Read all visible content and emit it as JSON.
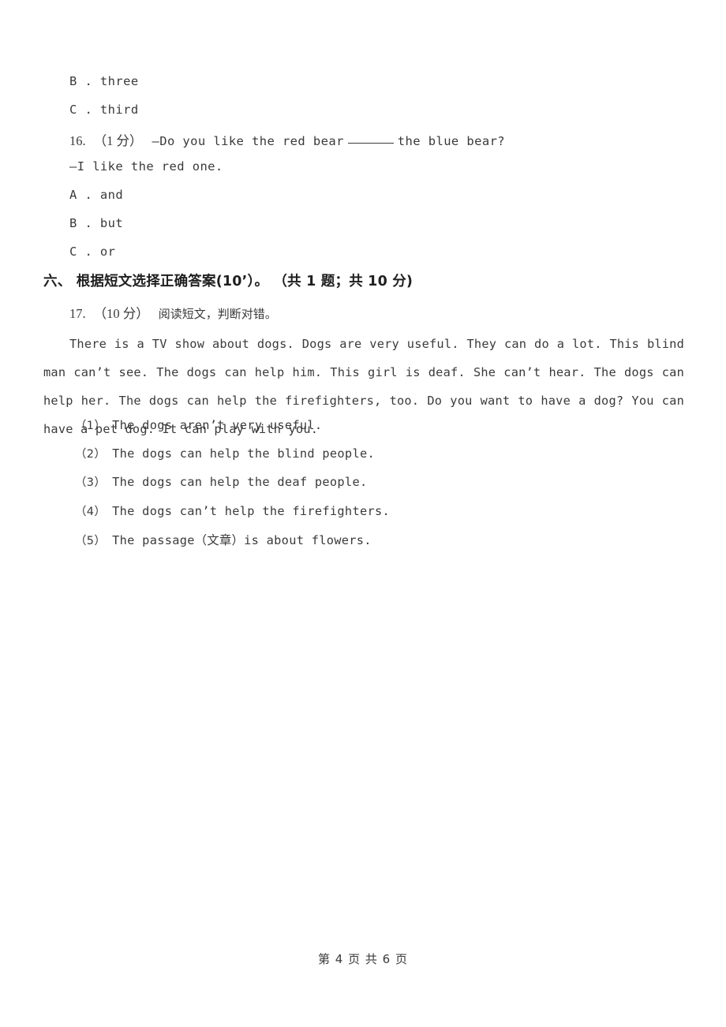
{
  "document": {
    "type": "english-exam-paper",
    "page_background": "#ffffff",
    "text_color": "#3a3a3a"
  },
  "carryover_choices": [
    {
      "label": "B . three"
    },
    {
      "label": "C . third"
    }
  ],
  "question16": {
    "number": "16.",
    "points": "（1 分）",
    "stem_before_blank": "—Do you like the red bear",
    "stem_after_blank": "the blue bear?",
    "answer_line": "—I like the red one.",
    "choices": [
      {
        "label": "A . and"
      },
      {
        "label": "B . but"
      },
      {
        "label": "C . or"
      }
    ]
  },
  "section": {
    "heading": "六、 根据短文选择正确答案(10’）。 （共 1 题；共 10 分)"
  },
  "question17": {
    "number": "17.",
    "points": "（10 分）",
    "instruction": "阅读短文，判断对错。",
    "passage": "There is a TV show about dogs. Dogs are very useful. They can do a lot. This blind man can’t see. The dogs can help him. This girl is deaf. She can’t hear. The dogs can help her. The dogs can help the firefighters, too. Do you want to have a dog? You can have a pet dog. It can play with you.",
    "sub_questions": [
      {
        "marker": "（1）",
        "text": "The dogs aren’t very useful."
      },
      {
        "marker": "（2）",
        "text": "The dogs can help the blind people."
      },
      {
        "marker": "（3）",
        "text": "The dogs can help the deaf people."
      },
      {
        "marker": "（4）",
        "text": "The dogs can’t help the firefighters."
      },
      {
        "marker": "（5）",
        "text": "The passage（文章）is about flowers."
      }
    ]
  },
  "footer": {
    "text": "第 4 页 共 6 页",
    "current_page": "4",
    "total_pages": "6"
  }
}
